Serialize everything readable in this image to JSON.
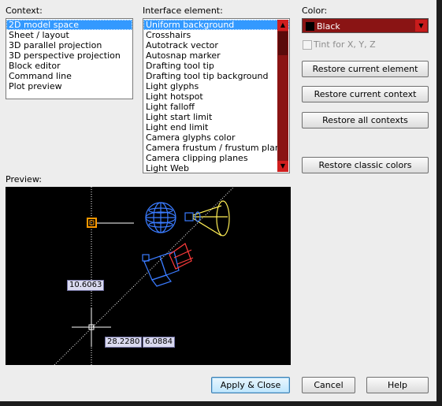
{
  "labels": {
    "context": "Context:",
    "interface_element": "Interface element:",
    "color": "Color:",
    "preview": "Preview:"
  },
  "context_list": {
    "items": [
      "2D model space",
      "Sheet / layout",
      "3D parallel projection",
      "3D perspective projection",
      "Block editor",
      "Command line",
      "Plot preview"
    ],
    "selected": "2D model space"
  },
  "interface_list": {
    "items": [
      "Uniform background",
      "Crosshairs",
      "Autotrack vector",
      "Autosnap marker",
      "Drafting tool tip",
      "Drafting tool tip background",
      "Light glyphs",
      "Light hotspot",
      "Light falloff",
      "Light start limit",
      "Light end limit",
      "Camera glyphs color",
      "Camera frustum / frustum plane",
      "Camera clipping planes",
      "Light Web"
    ],
    "selected": "Uniform background"
  },
  "color": {
    "value": "Black",
    "swatch": "#000000",
    "tint_label": "Tint for X, Y, Z"
  },
  "buttons": {
    "restore_element": "Restore current element",
    "restore_context": "Restore current context",
    "restore_all": "Restore all contexts",
    "restore_classic": "Restore classic colors",
    "apply_close": "Apply & Close",
    "cancel": "Cancel",
    "help": "Help"
  },
  "preview": {
    "dim_vertical": "10.6063",
    "dim_x": "28.2280",
    "dim_y": "6.0884"
  },
  "colors": {
    "selection": "#3399ff",
    "scrollbar": "#8a1414",
    "preview_bg": "#000000",
    "autosnap_marker": "#ff9900",
    "light_glyph": "#3a7bff",
    "camera": "#3a7bff",
    "frustum": "#ffee55"
  }
}
